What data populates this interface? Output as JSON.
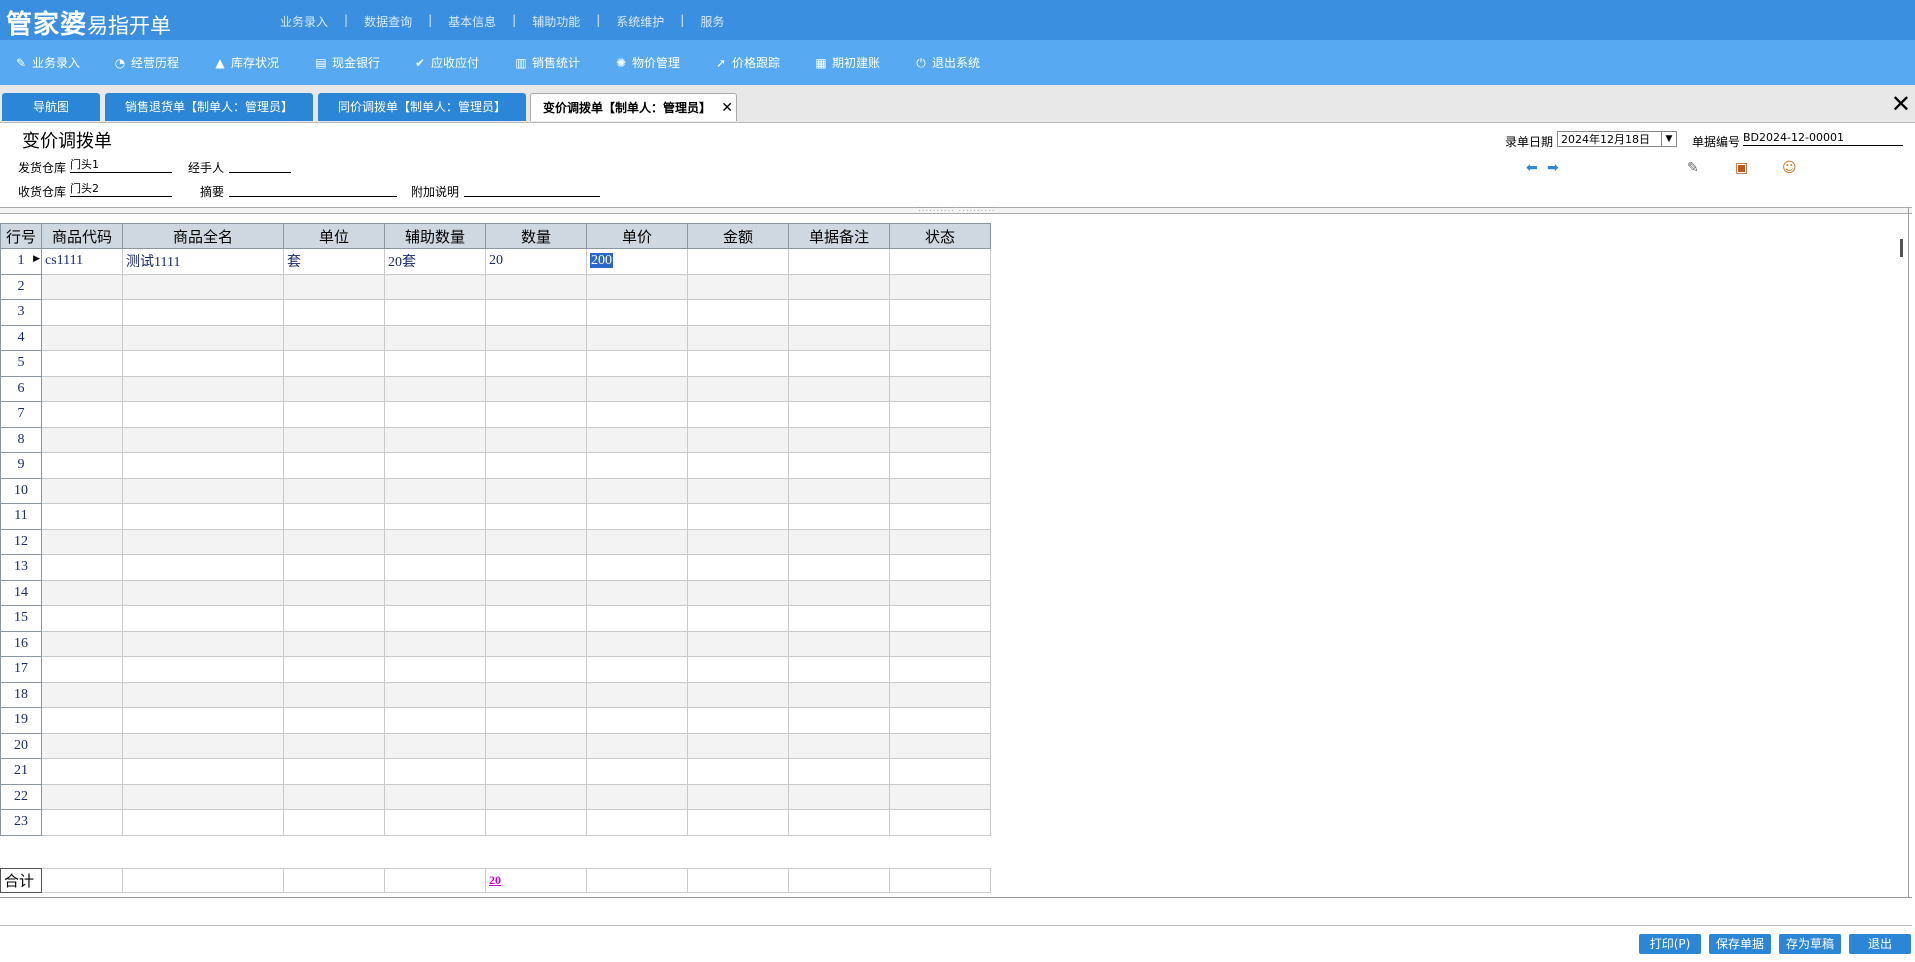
{
  "app": {
    "logo_main": "管家婆",
    "logo_sub": "易指开单"
  },
  "top_nav": [
    "业务录入",
    "数据查询",
    "基本信息",
    "辅助功能",
    "系统维护",
    "服务"
  ],
  "toolbar": [
    {
      "label": "业务录入",
      "icon": "pencil-icon"
    },
    {
      "label": "经营历程",
      "icon": "pie-chart-icon"
    },
    {
      "label": "库存状况",
      "icon": "flame-icon"
    },
    {
      "label": "现金银行",
      "icon": "book-icon"
    },
    {
      "label": "应收应付",
      "icon": "check-circle-icon"
    },
    {
      "label": "销售统计",
      "icon": "bar-chart-icon"
    },
    {
      "label": "物价管理",
      "icon": "gear-icon"
    },
    {
      "label": "价格跟踪",
      "icon": "arrow-up-right-icon"
    },
    {
      "label": "期初建账",
      "icon": "grid-icon"
    },
    {
      "label": "退出系统",
      "icon": "power-icon"
    }
  ],
  "tabs": [
    {
      "label": "导航图"
    },
    {
      "label": "销售退货单【制单人：管理员】"
    },
    {
      "label": "同价调拨单【制单人：管理员】"
    },
    {
      "label": "变价调拨单【制单人：管理员】",
      "active": true
    }
  ],
  "form": {
    "title": "变价调拨单",
    "from_wh_label": "发货仓库",
    "from_wh_value": "门头1",
    "handler_label": "经手人",
    "handler_value": "",
    "to_wh_label": "收货仓库",
    "to_wh_value": "门头2",
    "summary_label": "摘要",
    "summary_value": "",
    "note_label": "附加说明",
    "note_value": "",
    "date_label": "录单日期",
    "date_value": "2024年12月18日",
    "docno_label": "单据编号",
    "docno_value": "BD2024-12-00001"
  },
  "grid": {
    "headers": [
      "行号",
      "商品代码",
      "商品全名",
      "单位",
      "辅助数量",
      "数量",
      "单价",
      "金额",
      "单据备注",
      "状态"
    ],
    "rows": [
      [
        "1",
        "cs1111",
        "测试1111",
        "套",
        "20套",
        "20",
        "200",
        "",
        "",
        ""
      ],
      [
        "2",
        "",
        "",
        "",
        "",
        "",
        "",
        "",
        "",
        ""
      ],
      [
        "3",
        "",
        "",
        "",
        "",
        "",
        "",
        "",
        "",
        ""
      ],
      [
        "4",
        "",
        "",
        "",
        "",
        "",
        "",
        "",
        "",
        ""
      ],
      [
        "5",
        "",
        "",
        "",
        "",
        "",
        "",
        "",
        "",
        ""
      ],
      [
        "6",
        "",
        "",
        "",
        "",
        "",
        "",
        "",
        "",
        ""
      ],
      [
        "7",
        "",
        "",
        "",
        "",
        "",
        "",
        "",
        "",
        ""
      ],
      [
        "8",
        "",
        "",
        "",
        "",
        "",
        "",
        "",
        "",
        ""
      ],
      [
        "9",
        "",
        "",
        "",
        "",
        "",
        "",
        "",
        "",
        ""
      ],
      [
        "10",
        "",
        "",
        "",
        "",
        "",
        "",
        "",
        "",
        ""
      ],
      [
        "11",
        "",
        "",
        "",
        "",
        "",
        "",
        "",
        "",
        ""
      ],
      [
        "12",
        "",
        "",
        "",
        "",
        "",
        "",
        "",
        "",
        ""
      ],
      [
        "13",
        "",
        "",
        "",
        "",
        "",
        "",
        "",
        "",
        ""
      ],
      [
        "14",
        "",
        "",
        "",
        "",
        "",
        "",
        "",
        "",
        ""
      ],
      [
        "15",
        "",
        "",
        "",
        "",
        "",
        "",
        "",
        "",
        ""
      ],
      [
        "16",
        "",
        "",
        "",
        "",
        "",
        "",
        "",
        "",
        ""
      ],
      [
        "17",
        "",
        "",
        "",
        "",
        "",
        "",
        "",
        "",
        ""
      ],
      [
        "18",
        "",
        "",
        "",
        "",
        "",
        "",
        "",
        "",
        ""
      ],
      [
        "19",
        "",
        "",
        "",
        "",
        "",
        "",
        "",
        "",
        ""
      ],
      [
        "20",
        "",
        "",
        "",
        "",
        "",
        "",
        "",
        "",
        ""
      ],
      [
        "21",
        "",
        "",
        "",
        "",
        "",
        "",
        "",
        "",
        ""
      ],
      [
        "22",
        "",
        "",
        "",
        "",
        "",
        "",
        "",
        "",
        ""
      ],
      [
        "23",
        "",
        "",
        "",
        "",
        "",
        "",
        "",
        "",
        ""
      ]
    ],
    "total_label": "合计",
    "total_qty": "20"
  },
  "buttons": [
    "打印(P)",
    "保存单据",
    "存为草稿",
    "退出"
  ]
}
